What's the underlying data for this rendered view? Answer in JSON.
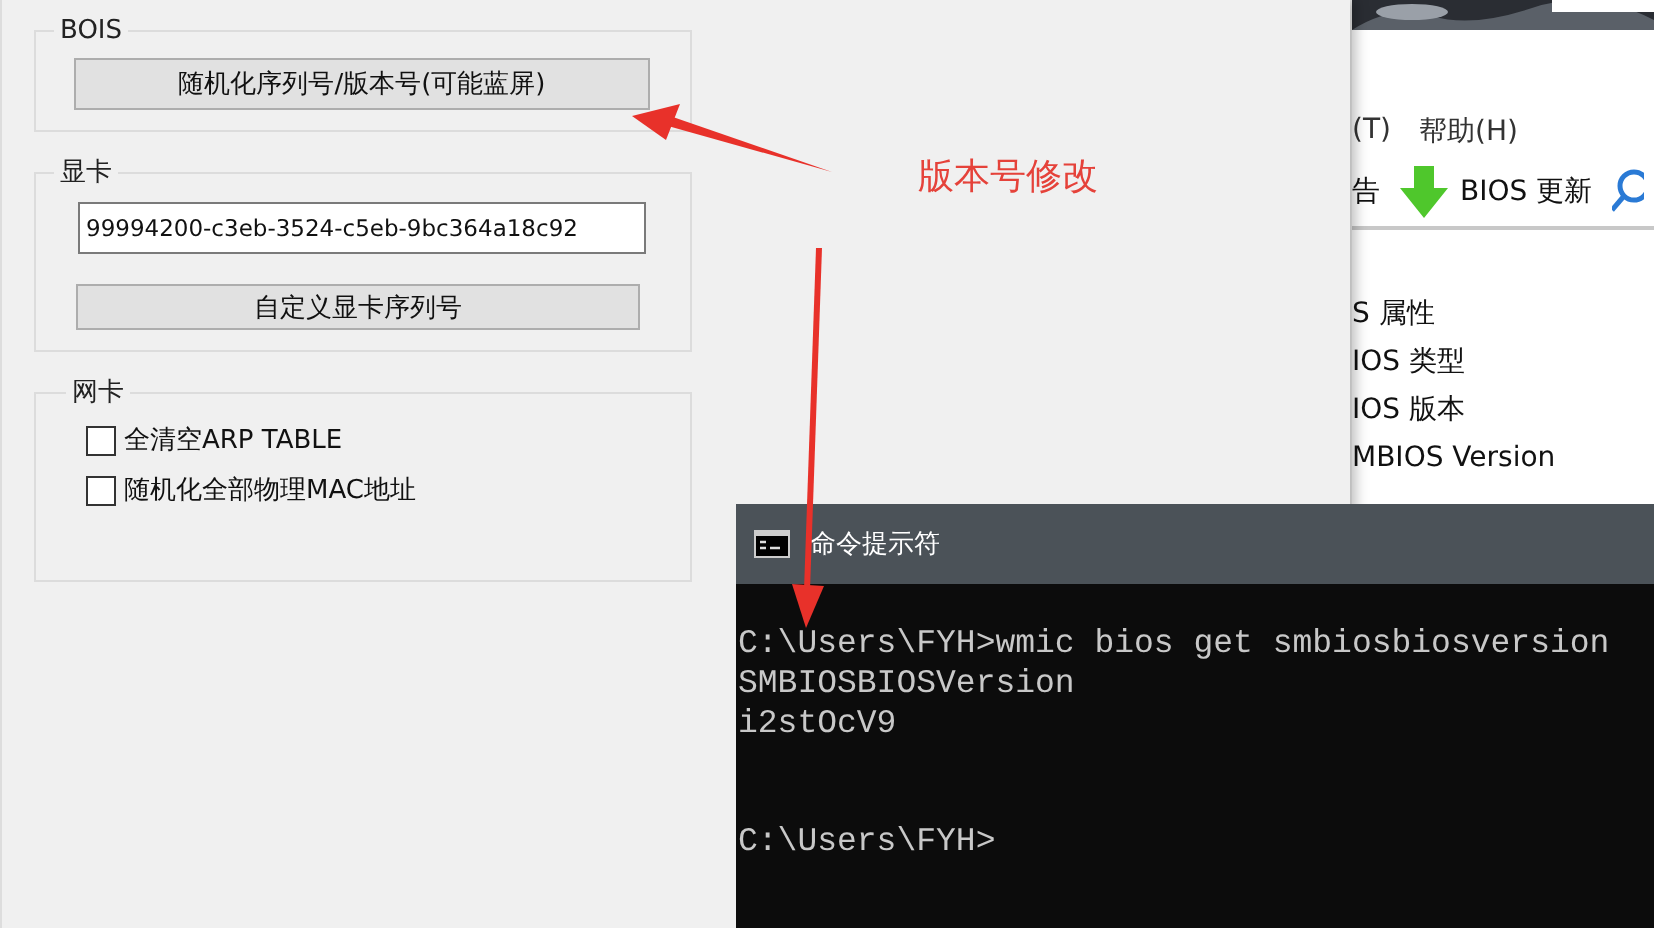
{
  "app_window": {
    "groups": [
      {
        "title": "BOIS",
        "items": [
          {
            "kind": "button",
            "label": "随机化序列号/版本号(可能蓝屏)"
          }
        ]
      },
      {
        "title": "显卡",
        "items": [
          {
            "kind": "field",
            "value": "99994200-c3eb-3524-c5eb-9bc364a18c92"
          },
          {
            "kind": "button",
            "label": "自定义显卡序列号"
          }
        ]
      },
      {
        "title": "网卡",
        "items": [
          {
            "kind": "checkbox",
            "label": "全清空ARP TABLE",
            "checked": false
          },
          {
            "kind": "checkbox",
            "label": "随机化全部物理MAC地址",
            "checked": false
          }
        ]
      }
    ]
  },
  "annotation": {
    "text": "版本号修改"
  },
  "bios_window": {
    "menu": [
      "(T)",
      "帮助(H)"
    ],
    "toolbar": [
      {
        "kind": "text",
        "label": "告"
      },
      {
        "kind": "download",
        "label": "BIOS 更新"
      },
      {
        "kind": "search"
      }
    ],
    "properties": [
      "S 属性",
      "IOS 类型",
      "IOS 版本",
      "MBIOS Version"
    ]
  },
  "console": {
    "title": "命令提示符",
    "blocks": [
      [
        "C:\\Users\\FYH>wmic bios get smbiosbiosversion",
        "SMBIOSBIOSVersion",
        "i2stOcV9"
      ],
      [
        "C:\\Users\\FYH>"
      ]
    ]
  }
}
